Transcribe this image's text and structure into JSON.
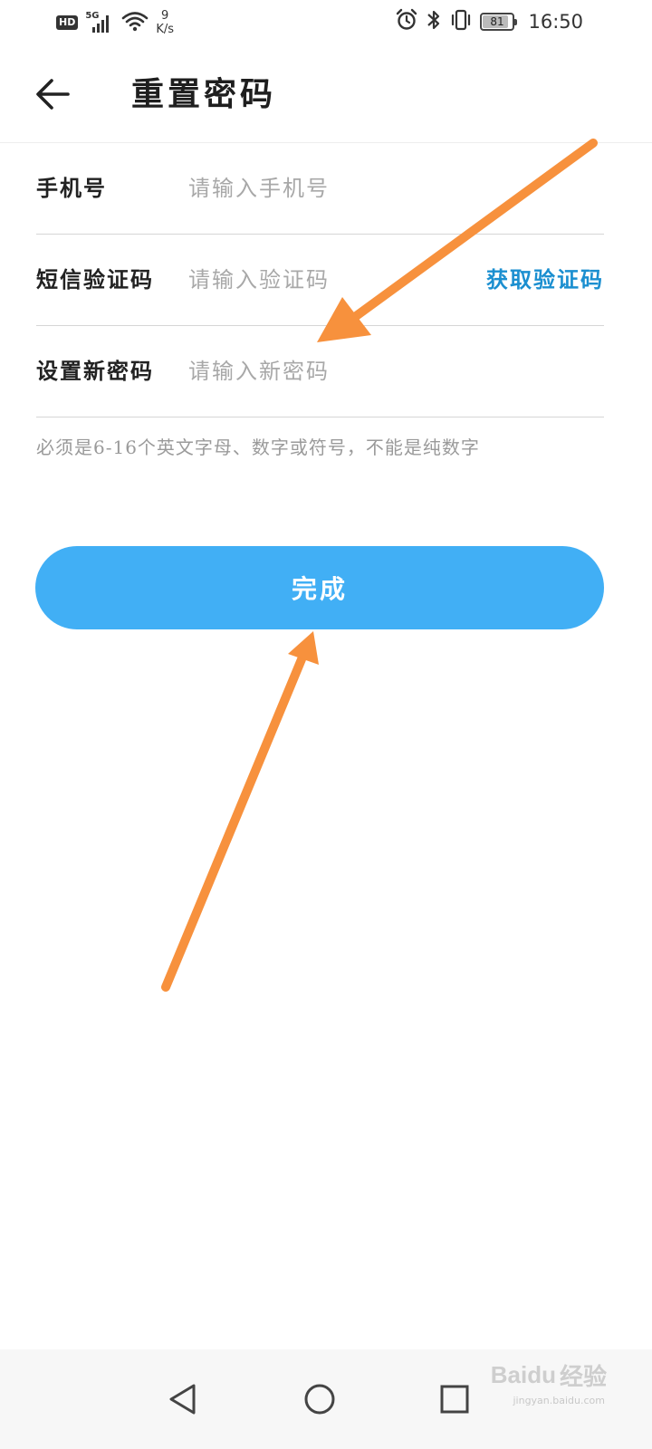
{
  "status_bar": {
    "hd": "HD",
    "network": "5G",
    "speed_value": "9",
    "speed_unit": "K/s",
    "battery": "81",
    "battery_level": 0.81,
    "time": "16:50",
    "icons": [
      "signal-icon",
      "wifi-icon",
      "alarm-icon",
      "bluetooth-icon",
      "vibrate-icon",
      "battery-icon"
    ]
  },
  "header": {
    "title": "重置密码",
    "back_icon": "back-arrow-icon"
  },
  "form": {
    "phone": {
      "label": "手机号",
      "placeholder": "请输入手机号",
      "value": ""
    },
    "sms_code": {
      "label": "短信验证码",
      "placeholder": "请输入验证码",
      "value": "",
      "action": "获取验证码"
    },
    "new_password": {
      "label": "设置新密码",
      "placeholder": "请输入新密码",
      "value": ""
    },
    "hint": "必须是6-16个英文字母、数字或符号，不能是纯数字"
  },
  "submit": {
    "label": "完成"
  },
  "nav_bar": {
    "icons": [
      "back-triangle-icon",
      "home-circle-icon",
      "recents-square-icon"
    ]
  },
  "watermark": {
    "text": "经验",
    "brand": "Baidu",
    "url": "jingyan.baidu.com"
  },
  "colors": {
    "primary_button": "#41aff5",
    "link": "#1b8fd0",
    "annotation_arrow": "#f7913d"
  }
}
